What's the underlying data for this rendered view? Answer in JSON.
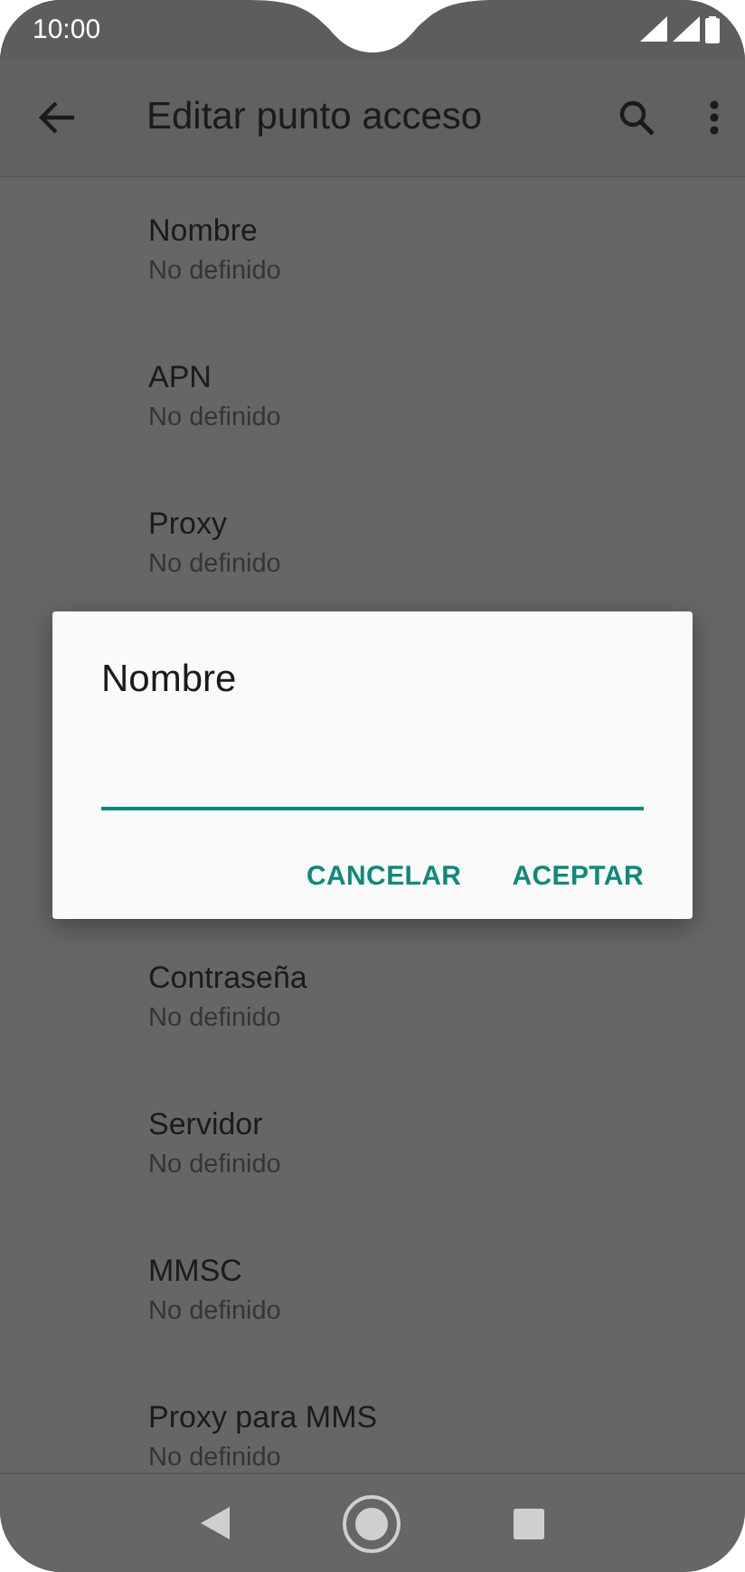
{
  "status_bar": {
    "time": "10:00"
  },
  "app_bar": {
    "title": "Editar punto acceso"
  },
  "settings_above_dialog": [
    {
      "title": "Nombre",
      "value": "No definido"
    },
    {
      "title": "APN",
      "value": "No definido"
    },
    {
      "title": "Proxy",
      "value": "No definido"
    }
  ],
  "settings_below_dialog": [
    {
      "title": "Contraseña",
      "value": "No definido"
    },
    {
      "title": "Servidor",
      "value": "No definido"
    },
    {
      "title": "MMSC",
      "value": "No definido"
    },
    {
      "title": "Proxy para MMS",
      "value": "No definido"
    }
  ],
  "dialog": {
    "title": "Nombre",
    "buttons": [
      "CANCELAR",
      "ACEPTAR"
    ]
  }
}
